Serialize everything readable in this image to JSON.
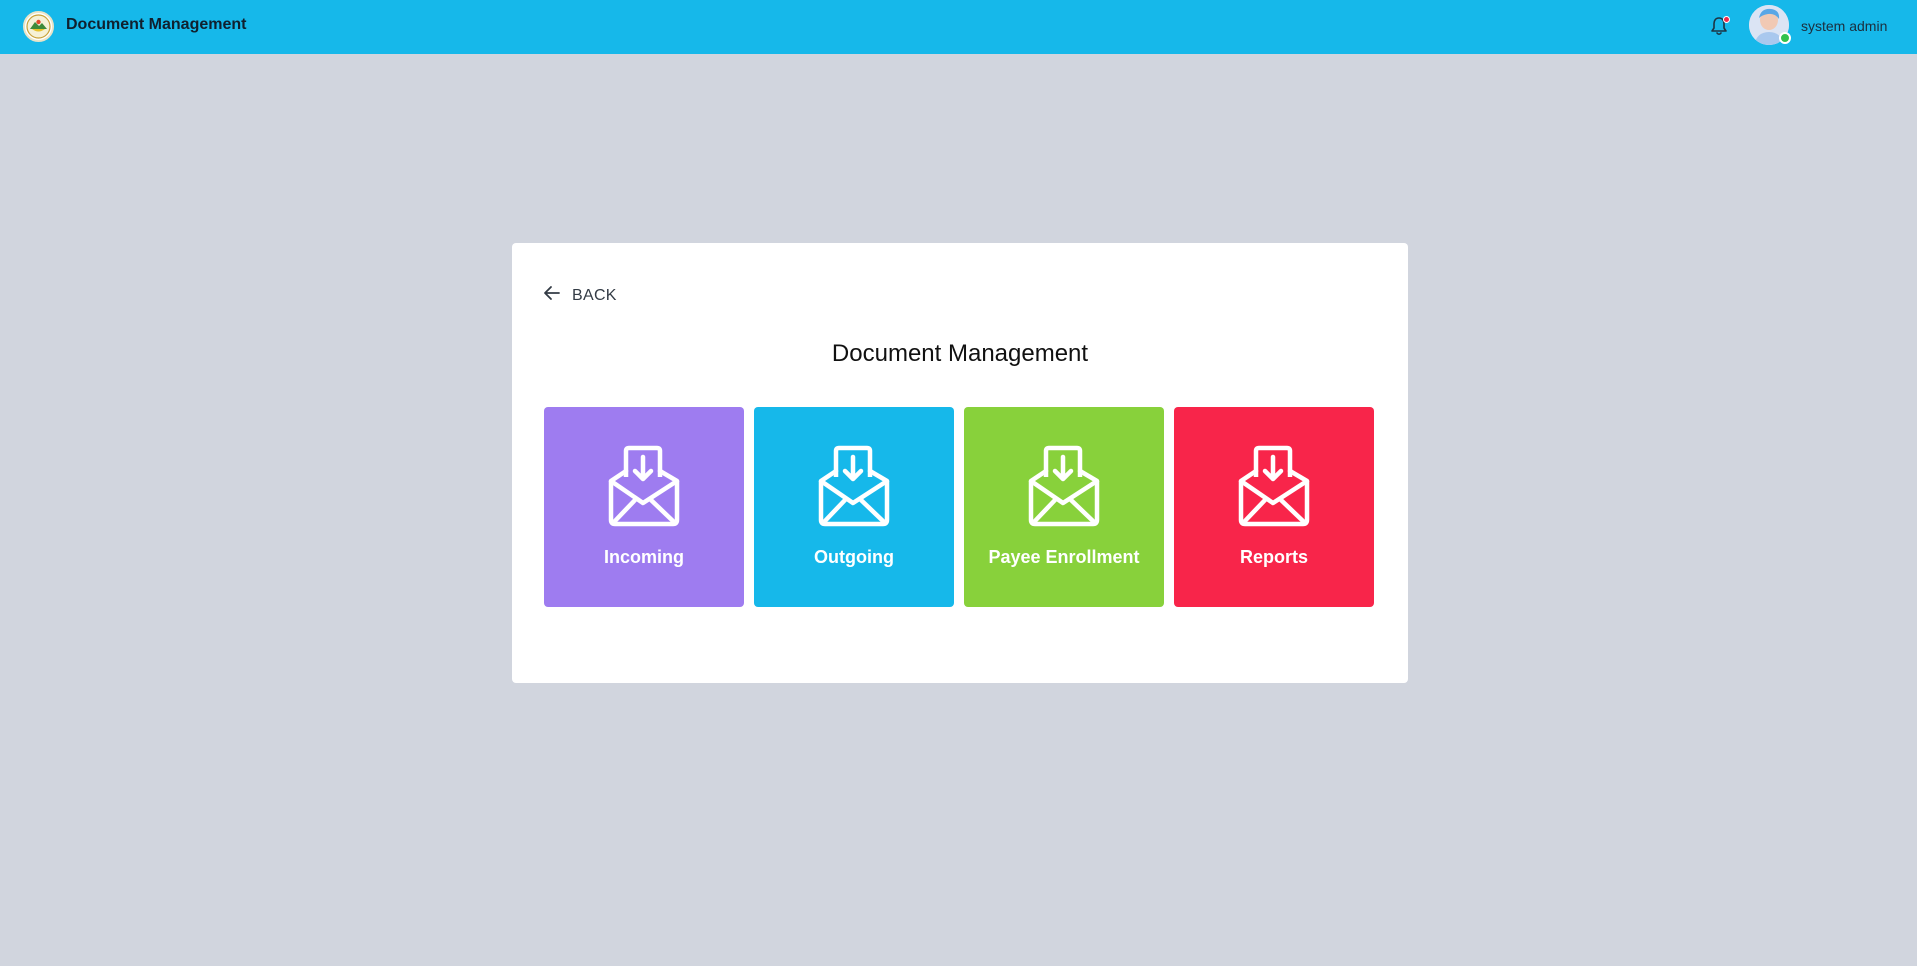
{
  "header": {
    "app_title": "Document Management",
    "logo_icon": "seal-logo-icon",
    "notification_icon": "bell-icon",
    "user_name": "system admin",
    "brand_color": "#16b8ea"
  },
  "page": {
    "back_label": "BACK",
    "title": "Document Management"
  },
  "tiles": [
    {
      "label": "Incoming",
      "icon": "envelope-download-icon",
      "color": "#9e7cf0"
    },
    {
      "label": "Outgoing",
      "icon": "envelope-download-icon",
      "color": "#16b8ea"
    },
    {
      "label": "Payee Enrollment",
      "icon": "envelope-download-icon",
      "color": "#88d13b"
    },
    {
      "label": "Reports",
      "icon": "envelope-download-icon",
      "color": "#f8254a"
    }
  ]
}
